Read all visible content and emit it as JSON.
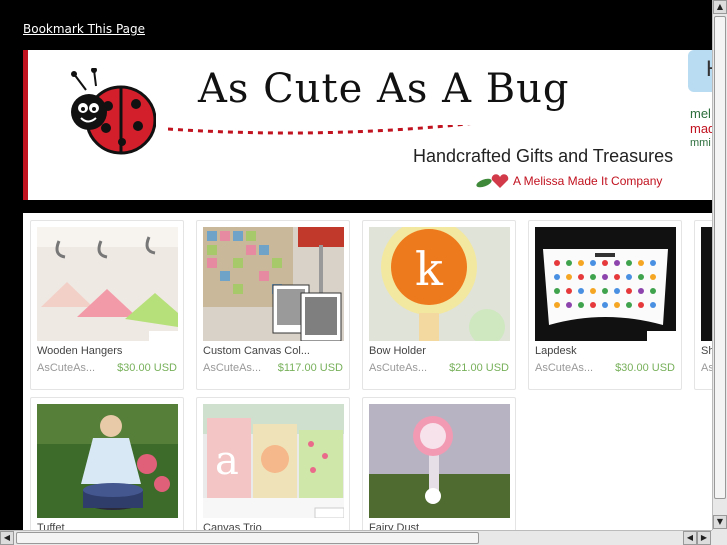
{
  "bookmark_label": "Bookmark This Page",
  "banner": {
    "title": "As Cute As A Bug",
    "subtitle": "Handcrafted Gifts and Treasures",
    "company": "A Melissa Made It Company",
    "side_tab_letter": "H",
    "side_brand_lines": [
      "mel",
      "mad",
      "mmi"
    ]
  },
  "items": [
    {
      "name": "Wooden Hangers",
      "shop": "AsCuteAs...",
      "price": "$30.00 USD"
    },
    {
      "name": "Custom Canvas Col...",
      "shop": "AsCuteAs...",
      "price": "$117.00 USD"
    },
    {
      "name": "Bow Holder",
      "shop": "AsCuteAs...",
      "price": "$21.00 USD"
    },
    {
      "name": "Lapdesk",
      "shop": "AsCuteAs...",
      "price": "$30.00 USD"
    },
    {
      "name": "Sh",
      "shop": "As",
      "price": ""
    },
    {
      "name": "Tuffet",
      "shop": "",
      "price": ""
    },
    {
      "name": "Canvas Trio",
      "shop": "",
      "price": ""
    },
    {
      "name": "Fairy Dust",
      "shop": "",
      "price": ""
    }
  ],
  "scrollbar": {
    "up": "▲",
    "down": "▼",
    "left": "◀",
    "right": "▶"
  },
  "colors": {
    "accent_red": "#c1121f",
    "price_green": "#77b05a",
    "brand_green": "#2c6e3c"
  }
}
